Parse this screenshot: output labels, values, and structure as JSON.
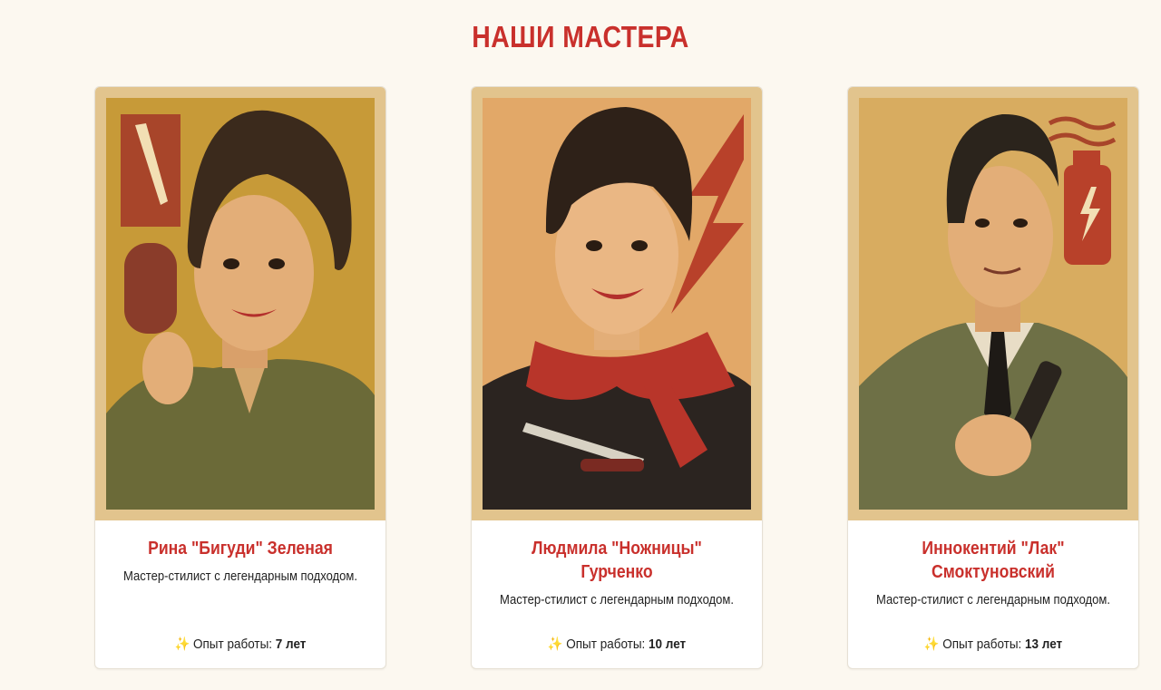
{
  "section": {
    "title": "НАШИ МАСТЕРА"
  },
  "masters": [
    {
      "name": "Рина \"Бигуди\" Зеленая",
      "description": "Мастер-стилист с легендарным подходом.",
      "experience_label": "Опыт работы:",
      "experience_value": "7 лет"
    },
    {
      "name": "Людмила \"Ножницы\" Гурченко",
      "description": "Мастер-стилист с легендарным подходом.",
      "experience_label": "Опыт работы:",
      "experience_value": "10 лет"
    },
    {
      "name": "Иннокентий \"Лак\" Смоктуновский",
      "description": "Мастер-стилист с легендарным подходом.",
      "experience_label": "Опыт работы:",
      "experience_value": "13 лет"
    }
  ],
  "icons": {
    "experience": "sparkle-icon"
  },
  "colors": {
    "accent": "#c9302c",
    "background": "#fcf8f0",
    "sparkle": "#e7b43a"
  }
}
